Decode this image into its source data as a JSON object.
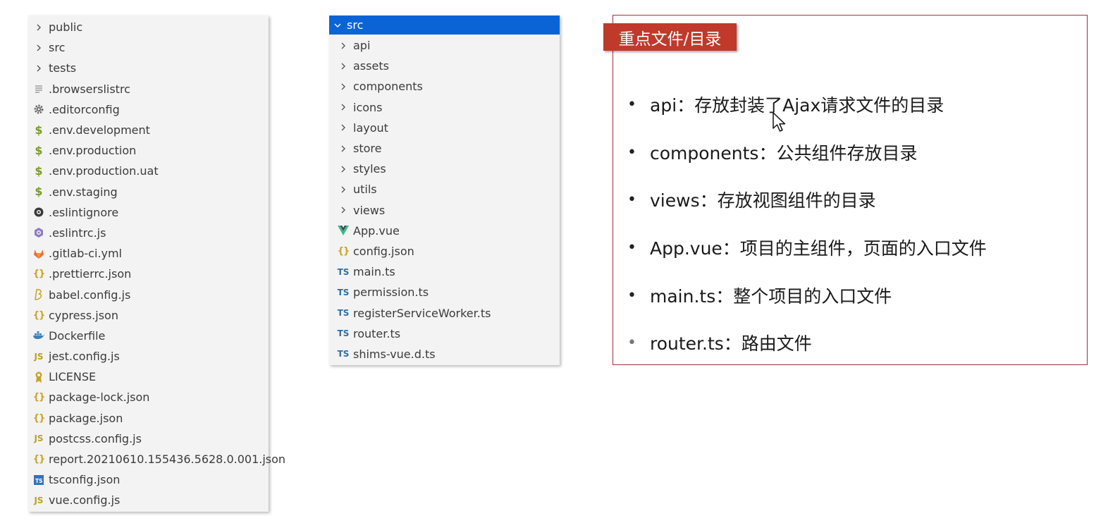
{
  "root_explorer": {
    "items": [
      {
        "label": "public",
        "icon": "chevron-right-icon"
      },
      {
        "label": "src",
        "icon": "chevron-right-icon"
      },
      {
        "label": "tests",
        "icon": "chevron-right-icon"
      },
      {
        "label": ".browserslistrc",
        "icon": "text-lines-icon"
      },
      {
        "label": ".editorconfig",
        "icon": "gear-icon"
      },
      {
        "label": ".env.development",
        "icon": "dollar-icon"
      },
      {
        "label": ".env.production",
        "icon": "dollar-icon"
      },
      {
        "label": ".env.production.uat",
        "icon": "dollar-icon"
      },
      {
        "label": ".env.staging",
        "icon": "dollar-icon"
      },
      {
        "label": ".eslintignore",
        "icon": "eslint-ignore-icon"
      },
      {
        "label": ".eslintrc.js",
        "icon": "eslint-icon"
      },
      {
        "label": ".gitlab-ci.yml",
        "icon": "gitlab-icon"
      },
      {
        "label": ".prettierrc.json",
        "icon": "json-braces-icon"
      },
      {
        "label": "babel.config.js",
        "icon": "babel-icon"
      },
      {
        "label": "cypress.json",
        "icon": "json-braces-icon"
      },
      {
        "label": "Dockerfile",
        "icon": "docker-icon"
      },
      {
        "label": "jest.config.js",
        "icon": "js-icon"
      },
      {
        "label": "LICENSE",
        "icon": "license-icon"
      },
      {
        "label": "package-lock.json",
        "icon": "json-braces-icon"
      },
      {
        "label": "package.json",
        "icon": "json-braces-icon"
      },
      {
        "label": "postcss.config.js",
        "icon": "js-icon"
      },
      {
        "label": "report.20210610.155436.5628.0.001.json",
        "icon": "json-braces-icon"
      },
      {
        "label": "tsconfig.json",
        "icon": "tsconfig-icon"
      },
      {
        "label": "vue.config.js",
        "icon": "js-icon"
      }
    ]
  },
  "src_explorer": {
    "folder_label": "src",
    "items": [
      {
        "label": "api",
        "icon": "chevron-right-icon"
      },
      {
        "label": "assets",
        "icon": "chevron-right-icon"
      },
      {
        "label": "components",
        "icon": "chevron-right-icon"
      },
      {
        "label": "icons",
        "icon": "chevron-right-icon"
      },
      {
        "label": "layout",
        "icon": "chevron-right-icon"
      },
      {
        "label": "store",
        "icon": "chevron-right-icon"
      },
      {
        "label": "styles",
        "icon": "chevron-right-icon"
      },
      {
        "label": "utils",
        "icon": "chevron-right-icon"
      },
      {
        "label": "views",
        "icon": "chevron-right-icon"
      },
      {
        "label": "App.vue",
        "icon": "vue-icon"
      },
      {
        "label": "config.json",
        "icon": "json-braces-icon"
      },
      {
        "label": "main.ts",
        "icon": "ts-icon"
      },
      {
        "label": "permission.ts",
        "icon": "ts-icon"
      },
      {
        "label": "registerServiceWorker.ts",
        "icon": "ts-icon"
      },
      {
        "label": "router.ts",
        "icon": "ts-icon"
      },
      {
        "label": "shims-vue.d.ts",
        "icon": "ts-icon"
      }
    ]
  },
  "notes": {
    "badge": "重点文件/目录",
    "bullets": [
      "api：存放封装了Ajax请求文件的目录",
      "components：公共组件存放目录",
      "views：存放视图组件的目录",
      "App.vue：项目的主组件，页面的入口文件",
      "main.ts：整个项目的入口文件",
      "router.ts：路由文件"
    ]
  },
  "colors": {
    "selection": "#0a64d6",
    "badge": "#c0392b",
    "note_border": "#9c2f3f",
    "panel_bg": "#f3f3f3"
  }
}
